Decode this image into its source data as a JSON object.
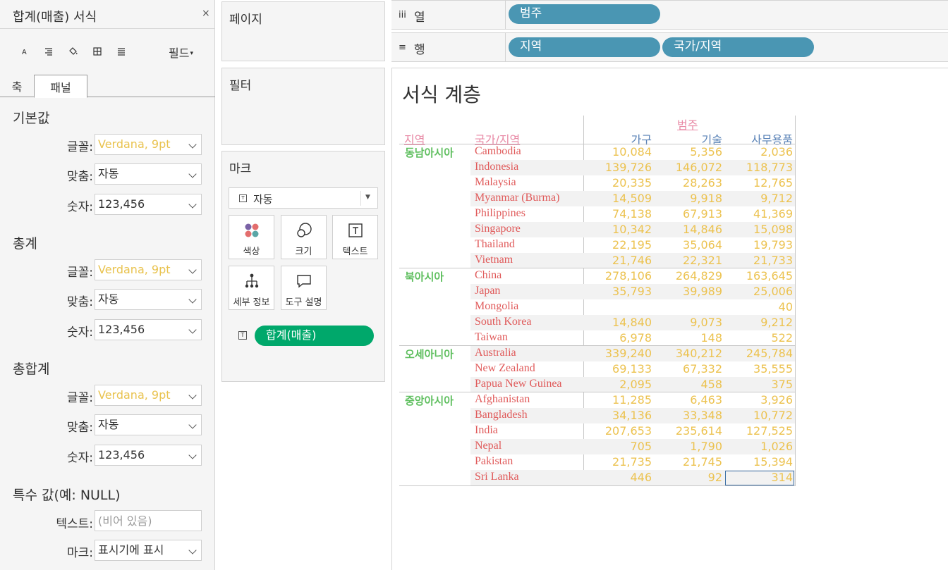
{
  "format_panel": {
    "title": "합계(매출) 서식",
    "close": "×",
    "toolbar": [
      "text-format-icon",
      "align-icon",
      "shading-icon",
      "borders-icon",
      "lines-icon"
    ],
    "fields_label": "필드",
    "fields_caret": "▾",
    "tabs": [
      "축",
      "패널"
    ],
    "active_tab": "패널",
    "sections": [
      {
        "title": "기본값",
        "rows": [
          {
            "label": "글꼴:",
            "value": "Verdana, 9pt"
          },
          {
            "label": "맞춤:",
            "value": "자동"
          },
          {
            "label": "숫자:",
            "value": "123,456"
          }
        ]
      },
      {
        "title": "총계",
        "rows": [
          {
            "label": "글꼴:",
            "value": "Verdana, 9pt"
          },
          {
            "label": "맞춤:",
            "value": "자동"
          },
          {
            "label": "숫자:",
            "value": "123,456"
          }
        ]
      },
      {
        "title": "총합계",
        "rows": [
          {
            "label": "글꼴:",
            "value": "Verdana, 9pt"
          },
          {
            "label": "맞춤:",
            "value": "자동"
          },
          {
            "label": "숫자:",
            "value": "123,456"
          }
        ]
      }
    ],
    "special": {
      "title": "특수 값(예: NULL)",
      "text_label": "텍스트:",
      "text_placeholder": "(비어 있음)",
      "mark_label": "마크:",
      "mark_value": "표시기에 표시"
    }
  },
  "cards": {
    "pages": "페이지",
    "filters": "필터",
    "marks": "마크",
    "mark_type": "자동",
    "mark_type_icon": "T",
    "mark_buttons": [
      {
        "label": "색상",
        "icon": "color-icon"
      },
      {
        "label": "크기",
        "icon": "size-icon"
      },
      {
        "label": "텍스트",
        "icon": "text-icon"
      },
      {
        "label": "세부 정보",
        "icon": "detail-icon"
      },
      {
        "label": "도구 설명",
        "icon": "tooltip-icon"
      }
    ],
    "mark_pill": "합계(매출)",
    "mark_pill_icon": "T"
  },
  "shelves": {
    "columns_label": "열",
    "columns_icon": "iii",
    "columns_pills": [
      "범주"
    ],
    "rows_label": "행",
    "rows_icon": "≡",
    "rows_pills": [
      "지역",
      "국가/지역"
    ]
  },
  "view": {
    "title": "서식 계층",
    "column_field": "범주",
    "row_header_region": "지역",
    "row_header_country": "국가/지역",
    "categories": [
      "가구",
      "기술",
      "사무용품"
    ],
    "groups": [
      {
        "region": "동남아시아",
        "rows": [
          {
            "country": "Cambodia",
            "values": [
              "10,084",
              "5,356",
              "2,036"
            ]
          },
          {
            "country": "Indonesia",
            "values": [
              "139,726",
              "146,072",
              "118,773"
            ]
          },
          {
            "country": "Malaysia",
            "values": [
              "20,335",
              "28,263",
              "12,765"
            ]
          },
          {
            "country": "Myanmar (Burma)",
            "values": [
              "14,509",
              "9,918",
              "9,712"
            ]
          },
          {
            "country": "Philippines",
            "values": [
              "74,138",
              "67,913",
              "41,369"
            ]
          },
          {
            "country": "Singapore",
            "values": [
              "10,342",
              "14,846",
              "15,098"
            ]
          },
          {
            "country": "Thailand",
            "values": [
              "22,195",
              "35,064",
              "19,793"
            ]
          },
          {
            "country": "Vietnam",
            "values": [
              "21,746",
              "22,321",
              "21,733"
            ]
          }
        ]
      },
      {
        "region": "북아시아",
        "rows": [
          {
            "country": "China",
            "values": [
              "278,106",
              "264,829",
              "163,645"
            ]
          },
          {
            "country": "Japan",
            "values": [
              "35,793",
              "39,989",
              "25,006"
            ]
          },
          {
            "country": "Mongolia",
            "values": [
              "",
              "",
              "40"
            ]
          },
          {
            "country": "South Korea",
            "values": [
              "14,840",
              "9,073",
              "9,212"
            ]
          },
          {
            "country": "Taiwan",
            "values": [
              "6,978",
              "148",
              "522"
            ]
          }
        ]
      },
      {
        "region": "오세아니아",
        "rows": [
          {
            "country": "Australia",
            "values": [
              "339,240",
              "340,212",
              "245,784"
            ]
          },
          {
            "country": "New Zealand",
            "values": [
              "69,133",
              "67,332",
              "35,555"
            ]
          },
          {
            "country": "Papua New Guinea",
            "values": [
              "2,095",
              "458",
              "375"
            ]
          }
        ]
      },
      {
        "region": "중앙아시아",
        "rows": [
          {
            "country": "Afghanistan",
            "values": [
              "11,285",
              "6,463",
              "3,926"
            ]
          },
          {
            "country": "Bangladesh",
            "values": [
              "34,136",
              "33,348",
              "10,772"
            ]
          },
          {
            "country": "India",
            "values": [
              "207,653",
              "235,614",
              "127,525"
            ]
          },
          {
            "country": "Nepal",
            "values": [
              "705",
              "1,790",
              "1,026"
            ]
          },
          {
            "country": "Pakistan",
            "values": [
              "21,735",
              "21,745",
              "15,394"
            ]
          },
          {
            "country": "Sri Lanka",
            "values": [
              "446",
              "92",
              "314"
            ]
          }
        ]
      }
    ],
    "colors": {
      "numbers": "#ecc24f",
      "countries": "#e05a5a",
      "regions": "#5fbf5f",
      "column_headers": "#5881b6",
      "field_labels": "#e889a5"
    }
  }
}
